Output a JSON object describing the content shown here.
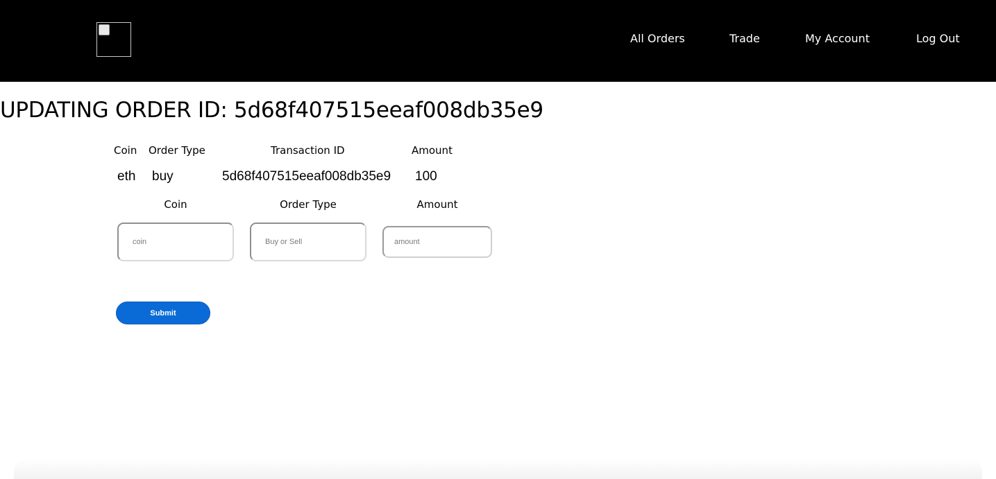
{
  "nav": {
    "logo_icon": "broken-image-icon",
    "links": [
      {
        "label": "All Orders"
      },
      {
        "label": "Trade"
      },
      {
        "label": "My Account"
      },
      {
        "label": "Log Out"
      }
    ]
  },
  "page": {
    "title": "UPDATING ORDER ID: 5d68f407515eeaf008db35e9"
  },
  "order": {
    "headers": {
      "coin": "Coin",
      "order_type": "Order Type",
      "transaction_id": "Transaction ID",
      "amount": "Amount"
    },
    "values": {
      "coin": "eth",
      "order_type": "buy",
      "transaction_id": "5d68f407515eeaf008db35e9",
      "amount": "100"
    }
  },
  "form": {
    "labels": {
      "coin": "Coin",
      "order_type": "Order Type",
      "amount": "Amount"
    },
    "placeholders": {
      "coin": "coin",
      "order_type": "Buy or Sell",
      "amount": "amount"
    },
    "values": {
      "coin": "",
      "order_type": "",
      "amount": ""
    },
    "submit_label": "Submit"
  },
  "colors": {
    "navbar_bg": "#000000",
    "submit_bg": "#0a6bd6"
  }
}
